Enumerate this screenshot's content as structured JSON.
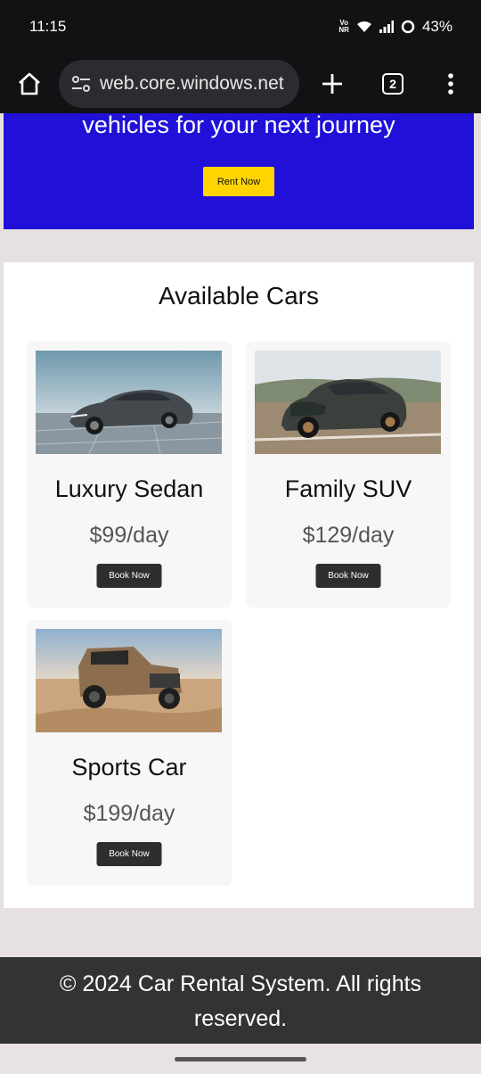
{
  "status_bar": {
    "time": "11:15",
    "volte_top": "Vo",
    "volte_bottom": "NR",
    "battery": "43%"
  },
  "browser": {
    "url": "web.core.windows.net",
    "tab_count": "2"
  },
  "hero": {
    "text": "vehicles for your next journey",
    "button": "Rent Now",
    "background": "#2010d8",
    "button_color": "#ffd400"
  },
  "section": {
    "title": "Available Cars"
  },
  "cars": [
    {
      "name": "Luxury Sedan",
      "price": "$99/day",
      "button": "Book Now"
    },
    {
      "name": "Family SUV",
      "price": "$129/day",
      "button": "Book Now"
    },
    {
      "name": "Sports Car",
      "price": "$199/day",
      "button": "Book Now"
    }
  ],
  "footer": {
    "text": "© 2024 Car Rental System. All rights reserved."
  }
}
